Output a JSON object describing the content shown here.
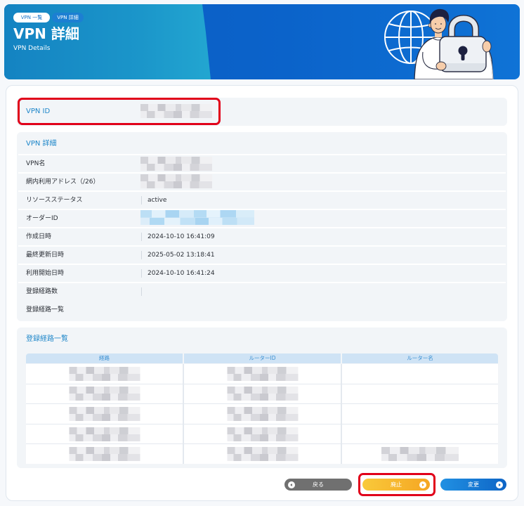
{
  "header": {
    "breadcrumb": {
      "list": "VPN 一覧",
      "current": "VPN 詳細"
    },
    "title": "VPN 詳細",
    "subtitle": "VPN Details",
    "illustration": [
      "globe-icon",
      "person-holding-padlock-icon"
    ]
  },
  "vpn_id": {
    "label": "VPN ID",
    "value_redacted": true
  },
  "details": {
    "heading": "VPN 詳細",
    "rows": [
      {
        "label": "VPN名",
        "value_redacted": true
      },
      {
        "label": "網内利用アドレス（/26）",
        "value_redacted": true
      },
      {
        "label": "リソースステータス",
        "value": "active"
      },
      {
        "label": "オーダーID",
        "value_redacted": true,
        "value_is_link": true
      },
      {
        "label": "作成日時",
        "value": "2024-10-10 16:41:09"
      },
      {
        "label": "最終更新日時",
        "value": "2025-05-02 13:18:41"
      },
      {
        "label": "利用開始日時",
        "value": "2024-10-10 16:41:24"
      },
      {
        "label": "登録経路数",
        "value": ""
      },
      {
        "label": "登録経路一覧"
      }
    ]
  },
  "routes": {
    "heading": "登録経路一覧",
    "columns": [
      "経路",
      "ルーターID",
      "ルーター名"
    ],
    "rows": [
      {
        "route_redacted": true,
        "router_id_redacted": true,
        "router_name_redacted": false
      },
      {
        "route_redacted": true,
        "router_id_redacted": true,
        "router_name_redacted": false
      },
      {
        "route_redacted": true,
        "router_id_redacted": true,
        "router_name_redacted": false
      },
      {
        "route_redacted": true,
        "router_id_redacted": true,
        "router_name_redacted": false
      },
      {
        "route_redacted": true,
        "router_id_redacted": true,
        "router_name_redacted": true
      }
    ]
  },
  "buttons": {
    "back": {
      "label": "戻る",
      "icon": "circle-arrow-left-icon"
    },
    "abolish": {
      "label": "廃止",
      "icon": "circle-arrow-right-icon"
    },
    "change": {
      "label": "変更",
      "icon": "circle-arrow-right-icon"
    }
  },
  "colors": {
    "header_blue": "#0b63ca",
    "header_teal": "#1b96ca",
    "section_heading": "#1d86c9",
    "back_button": "#707070",
    "abolish_button": "#f5a623",
    "change_button": "#1470cc",
    "highlight": "#e1001a"
  }
}
